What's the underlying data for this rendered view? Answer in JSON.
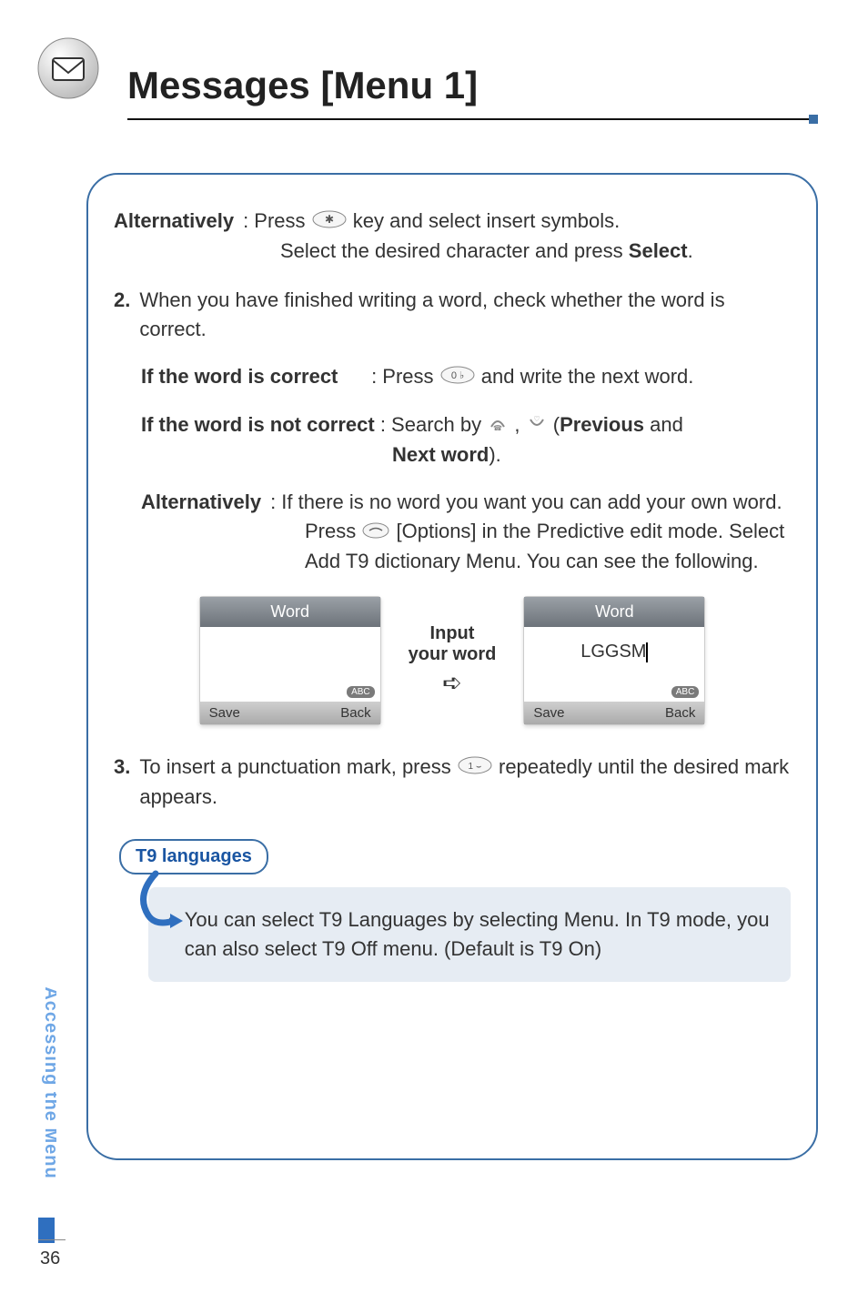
{
  "header": {
    "title": "Messages [Menu 1]"
  },
  "section": {
    "alt1": {
      "label": "Alternatively",
      "line1": ": Press",
      "line1b": "key and select insert symbols.",
      "line2": "Select the desired character and press",
      "line3_bold": "Select",
      "line3_tail": "."
    },
    "item2": {
      "num": "2.",
      "text": "When you have finished writing a word, check whether the word is correct."
    },
    "case_correct": {
      "k": "If the word is correct",
      "pre": ": Press",
      "post": "and write the next word."
    },
    "case_incorrect": {
      "k": "If the word is not correct",
      "pre": ": Search by",
      "mid": ",",
      "paren_open": "(",
      "prev_bold": "Previous",
      "and": " and",
      "next_bold": "Next word",
      "paren_close": ")."
    },
    "alt2": {
      "label": "Alternatively",
      "line1": ": If there is no word you want you can add your own word.",
      "line2a": "Press",
      "line2b": "[Options] in the Predictive edit mode. Select Add T9 dictionary Menu. You can see the following."
    },
    "demo": {
      "panel_title": "Word",
      "input_label1": "Input",
      "input_label2": "your word",
      "typed": "LGGSM",
      "abc": "ABC",
      "save": "Save",
      "back": "Back"
    },
    "item3": {
      "num": "3.",
      "pre": "To insert a punctuation mark, press",
      "post": "repeatedly until the desired mark appears."
    },
    "callout": {
      "title": "T9 languages",
      "body": "You can select T9 Languages by selecting Menu. In T9 mode, you can also select T9 Off menu. (Default is T9 On)"
    }
  },
  "side_label": "Accessing the Menu",
  "page_number": "36"
}
